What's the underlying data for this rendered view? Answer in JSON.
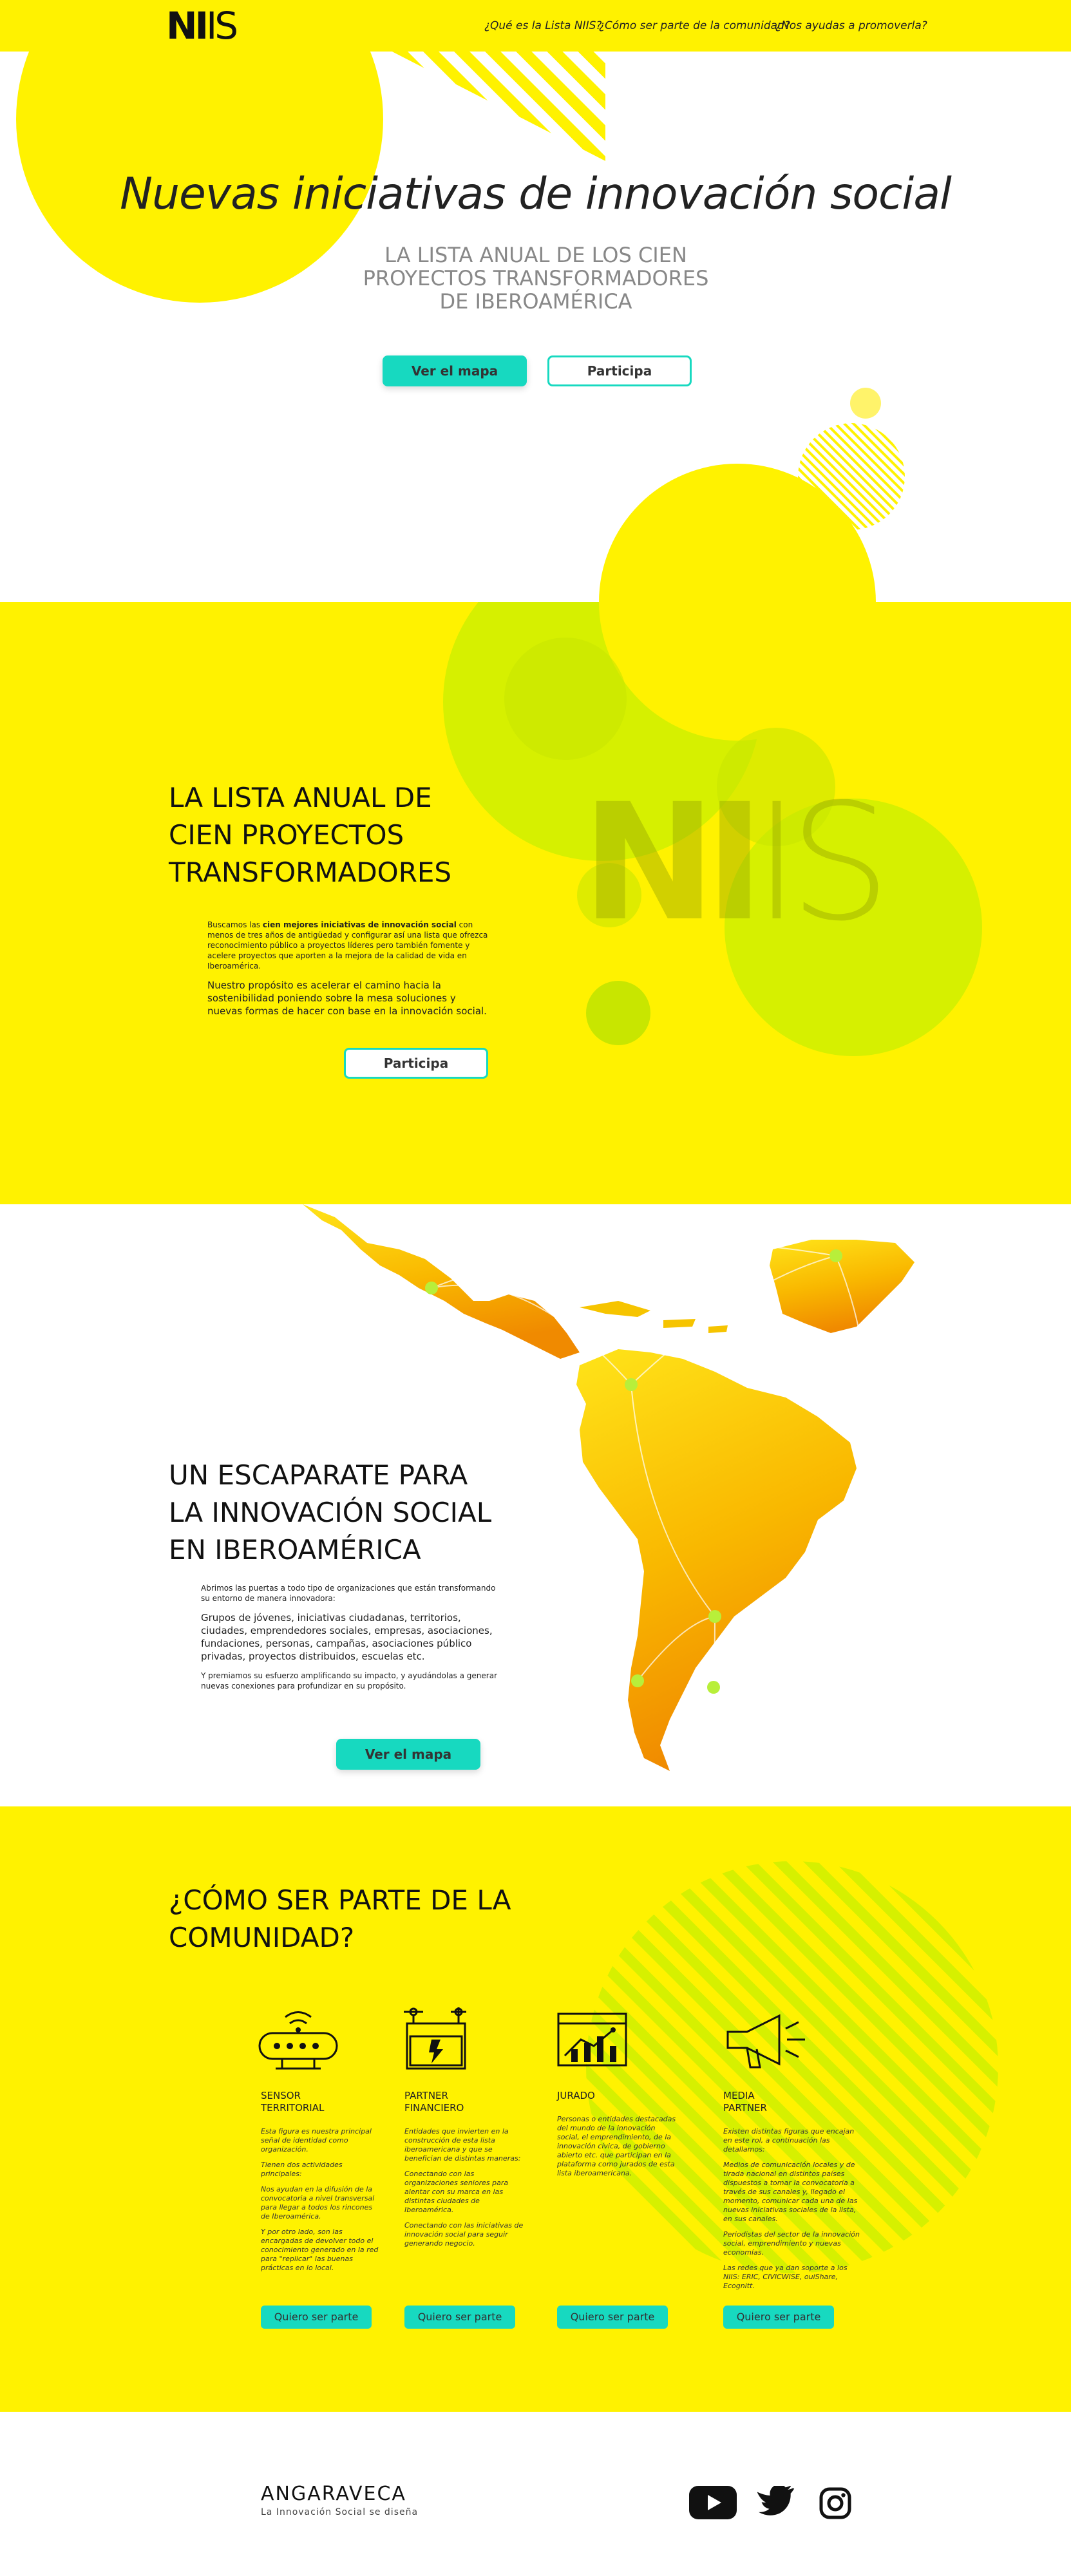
{
  "header": {
    "logo": {
      "bold": "NI",
      "thin": "IS"
    },
    "nav": [
      {
        "label": "¿Qué es la Lista NIIS?"
      },
      {
        "label": "¿Cómo ser parte de la comunidad?"
      },
      {
        "label": "¿Nos ayudas a promoverla?"
      }
    ]
  },
  "hero": {
    "title": "Nuevas iniciativas de innovación social",
    "subtitle_lines": [
      "LA LISTA ANUAL DE LOS CIEN",
      "PROYECTOS TRANSFORMADORES",
      "DE IBEROAMÉRICA"
    ],
    "primary_button": "Ver el mapa",
    "secondary_button": "Participa"
  },
  "lista": {
    "heading_lines": [
      "LA LISTA ANUAL DE",
      "CIEN PROYECTOS",
      "TRANSFORMADORES"
    ],
    "para1_pre": "Buscamos las ",
    "para1_bold": "cien mejores iniciativas de innovación social",
    "para1_post": " con menos de tres años de antigüedad y configurar así una lista que ofrezca reconocimiento público a proyectos líderes pero también fomente y acelere proyectos que aporten a la mejora de la calidad de vida en Iberoamérica.",
    "para2": "Nuestro propósito es acelerar el camino hacia la sostenibilidad poniendo sobre la mesa soluciones y nuevas formas de hacer con base en la innovación social.",
    "button": "Participa",
    "watermark": {
      "bold": "NI",
      "thin": "IS"
    }
  },
  "escaparate": {
    "heading_lines": [
      "UN ESCAPARATE PARA",
      "LA  INNOVACIÓN SOCIAL",
      "EN IBEROAMÉRICA"
    ],
    "para1": "Abrimos las puertas a todo tipo de organizaciones que están transformando su entorno de manera innovadora:",
    "para2": "Grupos de jóvenes, iniciativas ciudadanas, territorios, ciudades, emprendedores sociales, empresas, asociaciones, fundaciones, personas, campañas, asociaciones público privadas, proyectos distribuidos, escuelas etc.",
    "para3": "Y premiamos su esfuerzo amplificando su impacto, y ayudándolas a generar nuevas conexiones para profundizar en su propósito.",
    "button": "Ver el mapa"
  },
  "comunidad": {
    "heading_lines": [
      "¿CÓMO SER PARTE DE LA",
      "COMUNIDAD?"
    ],
    "cards": [
      {
        "icon": "sensor-icon",
        "title_lines": [
          "SENSOR",
          "TERRITORIAL"
        ],
        "paragraphs": [
          "Esta figura es nuestra principal señal de identidad como organización.",
          "Tienen dos actividades principales:",
          "Nos ayudan en la difusión de la convocatoria a nivel transversal para llegar a todos los rincones de Iberoamérica.",
          "Y por otro lado, son las encargadas de devolver todo el conocimiento generado en la red para \"replicar\" las buenas prácticas en lo local."
        ],
        "button": "Quiero ser parte"
      },
      {
        "icon": "battery-icon",
        "title_lines": [
          "PARTNER",
          "FINANCIERO"
        ],
        "paragraphs": [
          "Entidades que invierten en la construcción de esta lista iberoamericana y que se benefician de distintas maneras:",
          "Conectando con las organizaciones seniores para alentar con su marca en las distintas ciudades de Iberoamérica.",
          "Conectando con las iniciativas de innovación social para seguir generando negocio."
        ],
        "button": "Quiero ser parte"
      },
      {
        "icon": "chart-icon",
        "title_lines": [
          "JURADO"
        ],
        "paragraphs": [
          "Personas o entidades destacadas del mundo de la innovación social, el emprendimiento, de la innovación cívica, de gobierno abierto etc. que participan en la plataforma como jurados de esta lista iberoamericana."
        ],
        "button": "Quiero ser parte"
      },
      {
        "icon": "megaphone-icon",
        "title_lines": [
          "MEDIA",
          "PARTNER"
        ],
        "paragraphs": [
          "Existen distintas figuras que encajan en este rol, a continuación las detallamos:",
          "Medios de comunicación locales y de tirada nacional en distintos países dispuestos a tomar la convocatoria a través de sus canales y, llegado el momento, comunicar cada una de las nuevas iniciativas sociales de la lista, en sus canales.",
          "Periodistas del sector de la innovación social, emprendimiento y nuevas economías.",
          "Las redes que ya dan soporte a los NIIS: ERIC, CIVICWISE, ouiShare, Ecognitt."
        ],
        "button": "Quiero ser parte"
      }
    ]
  },
  "footer": {
    "brand": "ANGARAVECA",
    "tagline": "La Innovación Social se diseña",
    "social": [
      "youtube-icon",
      "twitter-icon",
      "instagram-icon"
    ]
  },
  "colors": {
    "yellow": "#fff200",
    "lime": "#d6f000",
    "teal": "#17d9c0",
    "orange": "#f29b00"
  }
}
